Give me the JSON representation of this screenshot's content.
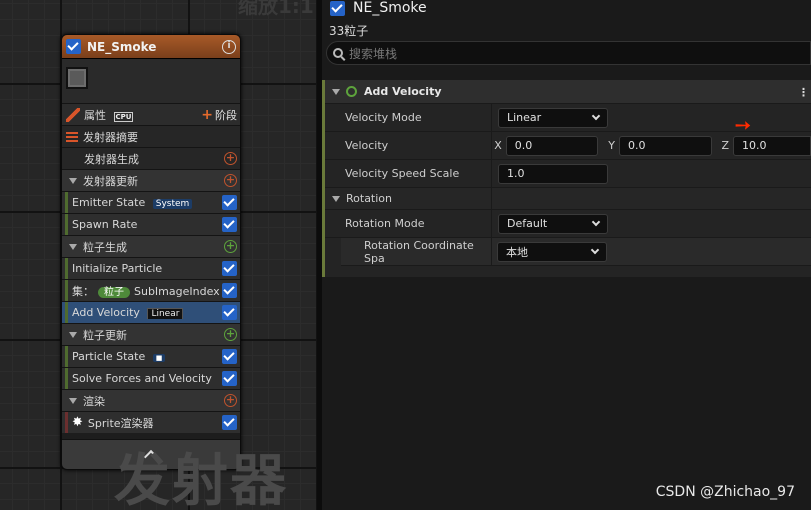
{
  "graph": {
    "zoom_text": "缩放1:1",
    "big_watermark": "发射器"
  },
  "node": {
    "title": "NE_Smoke",
    "props_label": "属性",
    "cpu_tag": "CPU",
    "stage_label": "阶段",
    "summary_label": "发射器摘要",
    "emitter_spawn": "发射器生成",
    "emitter_update": "发射器更新",
    "emitter_state": "Emitter State",
    "system_tag": "System",
    "spawn_rate": "Spawn Rate",
    "particle_spawn": "粒子生成",
    "init_particle": "Initialize Particle",
    "set_prefix": "集：",
    "set_pill": "粒子",
    "sub_image": "SubImageIndex",
    "add_velocity": "Add Velocity",
    "linear_tag": "Linear",
    "particle_update": "粒子更新",
    "particle_state": "Particle State",
    "solve_forces": "Solve Forces and Velocity",
    "render": "渲染",
    "sprite_renderer": "Sprite渲染器"
  },
  "panel": {
    "title": "NE_Smoke",
    "count": "33粒子",
    "search_placeholder": "搜索堆栈",
    "section": "Add Velocity",
    "velocity_mode_label": "Velocity Mode",
    "velocity_mode_value": "Linear",
    "velocity_label": "Velocity",
    "x_label": "X",
    "x_value": "0.0",
    "y_label": "Y",
    "y_value": "0.0",
    "z_label": "Z",
    "z_value": "10.0",
    "speed_scale_label": "Velocity Speed Scale",
    "speed_scale_value": "1.0",
    "rotation_label": "Rotation",
    "rotation_mode_label": "Rotation Mode",
    "rotation_mode_value": "Default",
    "rot_coord_label": "Rotation Coordinate Spa",
    "rot_coord_value": "本地",
    "more": "⋮"
  },
  "watermark": "CSDN @Zhichao_97",
  "colors": {
    "accent_blue": "#2563c7",
    "node_header": "#a85a28",
    "arrow": "#ff2a00"
  }
}
